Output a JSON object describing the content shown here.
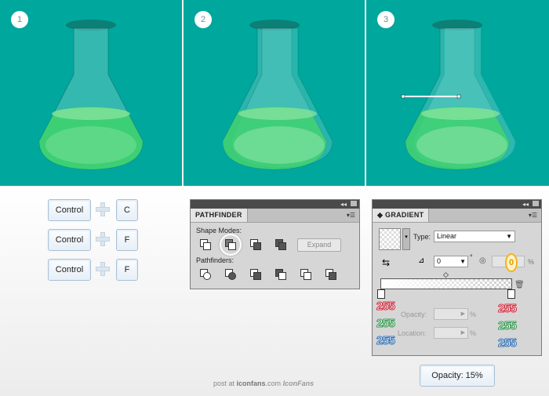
{
  "steps": [
    {
      "number": "1"
    },
    {
      "number": "2"
    },
    {
      "number": "3"
    }
  ],
  "keys": {
    "row1": {
      "modifier": "Control",
      "key": "C"
    },
    "row2": {
      "modifier": "Control",
      "key": "F"
    },
    "row3": {
      "modifier": "Control",
      "key": "F"
    }
  },
  "pathfinder": {
    "tab_label": "PATHFINDER",
    "shape_modes_label": "Shape Modes:",
    "pathfinders_label": "Pathfinders:",
    "expand_label": "Expand",
    "collapse_glyph": "◂◂"
  },
  "gradient": {
    "tab_label": "GRADIENT",
    "type_label": "Type:",
    "type_value": "Linear",
    "angle_value": "0",
    "degree_symbol": "°",
    "aspect_value": "0",
    "percent": "%",
    "opacity_label": "Opacity:",
    "location_label": "Location:",
    "collapse_glyph": "◂◂",
    "left_stop": {
      "r": "255",
      "g": "255",
      "b": "255"
    },
    "right_stop": {
      "r": "255",
      "g": "255",
      "b": "255"
    }
  },
  "opacity_note": "Opacity: 15%",
  "footer": {
    "prefix": "post at ",
    "site": "iconfans",
    "suffix": ".com",
    "logo": "IconFans"
  },
  "colors": {
    "teal": "#00a79d",
    "red": "#d1263a",
    "green": "#2e9b4c",
    "blue": "#2f6db4"
  }
}
